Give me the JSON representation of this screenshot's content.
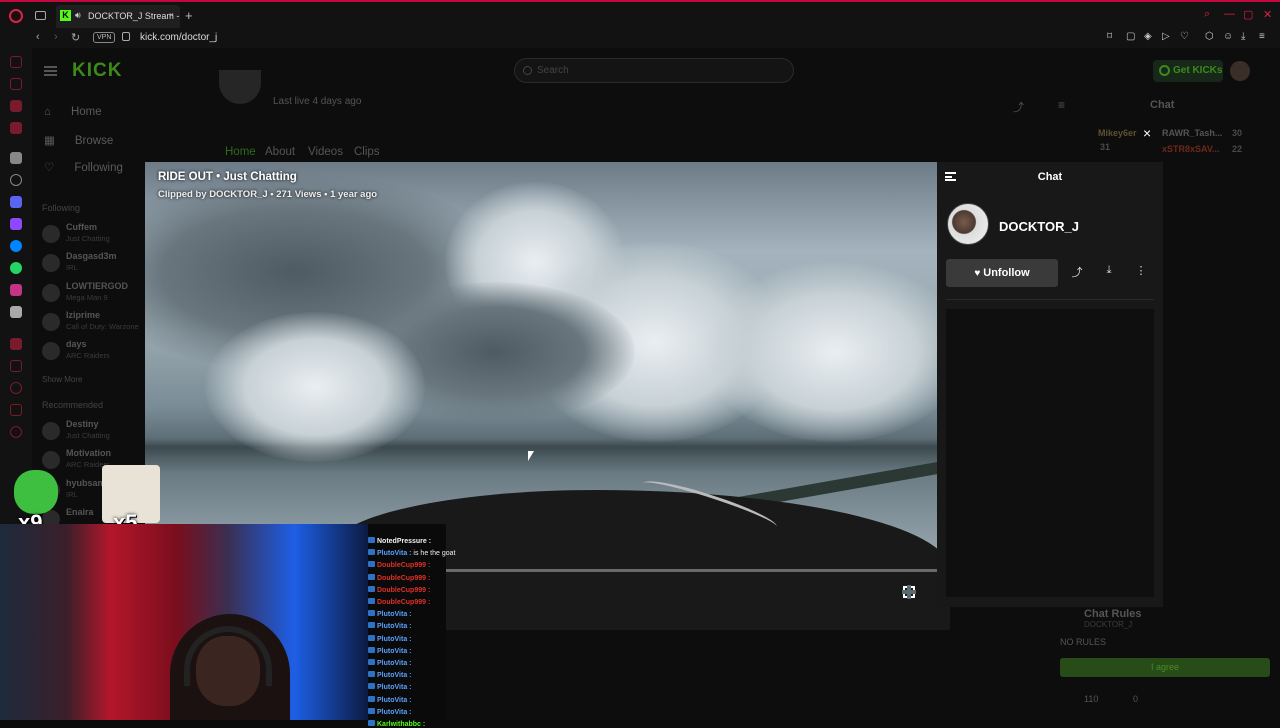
{
  "browser": {
    "tab_title": "DOCKTOR_J Stream -",
    "new_tab": "+",
    "tab_close": "×",
    "vpn": "VPN",
    "url": "kick.com/doctor_j",
    "window_controls": [
      "⌕",
      "—",
      "▢",
      "✕"
    ]
  },
  "site": {
    "logo": "KICK",
    "search_placeholder": "Search",
    "get_kicks": "Get KICKs",
    "nav": [
      {
        "label": "Home",
        "icon": "home-icon"
      },
      {
        "label": "Browse",
        "icon": "browse-icon"
      },
      {
        "label": "Following",
        "icon": "heart-icon"
      }
    ],
    "following_title": "Following",
    "following": [
      {
        "name": "Cuffem",
        "cat": "Just Chatting"
      },
      {
        "name": "Dasgasd3m",
        "cat": "IRL"
      },
      {
        "name": "LOWTIERGOD",
        "cat": "Mega Man 9"
      },
      {
        "name": "Iziprime",
        "cat": "Call of Duty: Warzone"
      },
      {
        "name": "days",
        "cat": "ARC Raiders"
      }
    ],
    "show_more": "Show More",
    "recommended_title": "Recommended",
    "recommended": [
      {
        "name": "Destiny",
        "cat": "Just Chatting"
      },
      {
        "name": "Motivation",
        "cat": "ARC Raiders"
      },
      {
        "name": "hyubsama",
        "cat": "IRL"
      },
      {
        "name": "Enaira",
        "cat": ""
      }
    ],
    "last_live": "Last live 4 days ago",
    "profile_tabs": [
      "Home",
      "About",
      "Videos",
      "Clips"
    ],
    "chat_title": "Chat",
    "leaderboard": [
      {
        "name": "Mikey6er",
        "value": "31"
      },
      {
        "name": "RAWR_Tash...",
        "value": "30"
      },
      {
        "name": "xSTR8xSAV...",
        "value": "22"
      }
    ],
    "chat_rules_title": "Chat Rules",
    "chat_rules_user": "DOCKTOR_J",
    "no_rules": "NO RULES",
    "agree": "I agree",
    "counts": [
      "110",
      "0"
    ]
  },
  "modal": {
    "title": "RIDE OUT • Just Chatting",
    "subtitle": "Clipped by DOCKTOR_J • 271 Views • 1 year ago",
    "close": "×",
    "chat_label": "Chat",
    "channel_name": "DOCKTOR_J",
    "unfollow": "Unfollow",
    "progress": 0.25
  },
  "overlay": {
    "emote1_count": "x9",
    "emote2_count": "x5",
    "chat_lines": [
      {
        "user": "NotedPressure :",
        "msg": "",
        "color": "#f0f0f0"
      },
      {
        "user": "PlutoVita :",
        "msg": "is he the goat",
        "color": "#5aa0ff"
      },
      {
        "user": "DoubleCup999 :",
        "msg": "",
        "color": "#e0302a"
      },
      {
        "user": "DoubleCup999 :",
        "msg": "",
        "color": "#e0302a"
      },
      {
        "user": "DoubleCup999 :",
        "msg": "",
        "color": "#e0302a"
      },
      {
        "user": "DoubleCup999 :",
        "msg": "",
        "color": "#e0302a"
      },
      {
        "user": "PlutoVita :",
        "msg": "",
        "color": "#5aa0ff"
      },
      {
        "user": "PlutoVita :",
        "msg": "",
        "color": "#5aa0ff"
      },
      {
        "user": "PlutoVita :",
        "msg": "",
        "color": "#5aa0ff"
      },
      {
        "user": "PlutoVita :",
        "msg": "",
        "color": "#5aa0ff"
      },
      {
        "user": "PlutoVita :",
        "msg": "",
        "color": "#5aa0ff"
      },
      {
        "user": "PlutoVita :",
        "msg": "",
        "color": "#5aa0ff"
      },
      {
        "user": "PlutoVita :",
        "msg": "",
        "color": "#5aa0ff"
      },
      {
        "user": "PlutoVita :",
        "msg": "",
        "color": "#5aa0ff"
      },
      {
        "user": "PlutoVita :",
        "msg": "",
        "color": "#5aa0ff"
      },
      {
        "user": "Karlwithabbc :",
        "msg": "",
        "color": "#53fc18"
      }
    ]
  },
  "colors": {
    "accent": "#53fc18",
    "opera_red": "#e01e47"
  }
}
